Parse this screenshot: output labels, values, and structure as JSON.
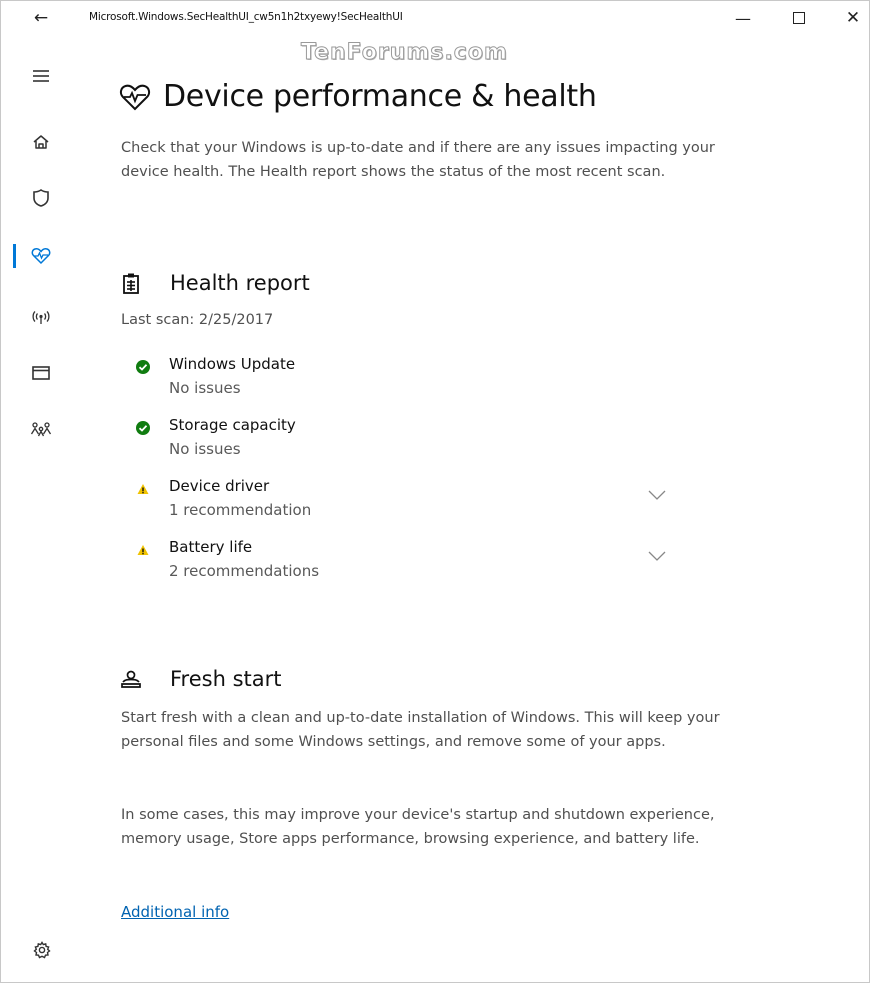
{
  "titlebar": {
    "back_glyph": "←",
    "title": "Microsoft.Windows.SecHealthUI_cw5n1h2txyewy!SecHealthUI",
    "minimize_glyph": "—",
    "close_glyph": "✕"
  },
  "watermark": "TenForums.com",
  "sidebar": {
    "items": [
      {
        "icon": "hamburger-menu-icon"
      },
      {
        "icon": "home-icon"
      },
      {
        "icon": "shield-icon"
      },
      {
        "icon": "heart-pulse-icon",
        "active": true
      },
      {
        "icon": "wireless-icon"
      },
      {
        "icon": "app-browser-icon"
      },
      {
        "icon": "family-icon"
      }
    ],
    "settings_icon": "gear-icon",
    "accent_color": "#0078d7"
  },
  "page": {
    "title": "Device performance & health",
    "description": "Check that your Windows is up-to-date and if there are any issues impacting your device health. The Health report shows the status of the most recent scan."
  },
  "health_report": {
    "title": "Health report",
    "last_scan": "Last scan: 2/25/2017",
    "items": [
      {
        "name": "Windows Update",
        "detail": "No issues",
        "status": "ok"
      },
      {
        "name": "Storage capacity",
        "detail": "No issues",
        "status": "ok"
      },
      {
        "name": "Device driver",
        "detail": "1 recommendation",
        "status": "warning"
      },
      {
        "name": "Battery life",
        "detail": "2 recommendations",
        "status": "warning"
      }
    ],
    "ok_color": "#107c10",
    "warning_color": "#f0c300"
  },
  "fresh_start": {
    "title": "Fresh start",
    "paragraph1": "Start fresh with a clean and up-to-date installation of Windows. This will keep your personal files and some Windows settings, and remove some of your apps.",
    "paragraph2": "In some cases, this may improve your device's startup and shutdown experience, memory usage, Store apps performance, browsing experience, and battery life.",
    "link": "Additional info"
  }
}
